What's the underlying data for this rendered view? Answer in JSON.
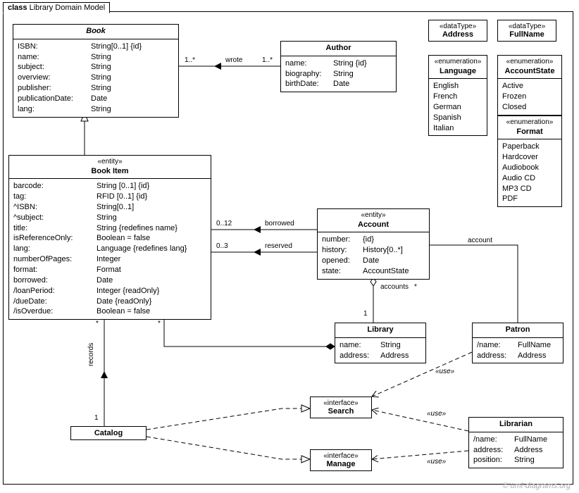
{
  "frame": {
    "keyword": "class",
    "title": "Library Domain Model"
  },
  "watermark": "© uml-diagrams.org",
  "book": {
    "name": "Book",
    "attrs": [
      {
        "n": "ISBN:",
        "t": "String[0..1] {id}"
      },
      {
        "n": "name:",
        "t": "String"
      },
      {
        "n": "subject:",
        "t": "String"
      },
      {
        "n": "overview:",
        "t": "String"
      },
      {
        "n": "publisher:",
        "t": "String"
      },
      {
        "n": "publicationDate:",
        "t": "Date"
      },
      {
        "n": "lang:",
        "t": "String"
      }
    ]
  },
  "author": {
    "name": "Author",
    "attrs": [
      {
        "n": "name:",
        "t": "String {id}"
      },
      {
        "n": "biography:",
        "t": "String"
      },
      {
        "n": "birthDate:",
        "t": "Date"
      }
    ]
  },
  "bookItem": {
    "stereo": "«entity»",
    "name": "Book Item",
    "attrs": [
      {
        "n": "barcode:",
        "t": "String [0..1] {id}"
      },
      {
        "n": "tag:",
        "t": "RFID [0..1] {id}"
      },
      {
        "n": "^ISBN:",
        "t": "String[0..1]"
      },
      {
        "n": "^subject:",
        "t": "String"
      },
      {
        "n": "title:",
        "t": "String {redefines name}"
      },
      {
        "n": "isReferenceOnly:",
        "t": "Boolean = false"
      },
      {
        "n": "lang:",
        "t": "Language {redefines lang}"
      },
      {
        "n": "numberOfPages:",
        "t": "Integer"
      },
      {
        "n": "format:",
        "t": "Format"
      },
      {
        "n": "borrowed:",
        "t": "Date"
      },
      {
        "n": "/loanPeriod:",
        "t": "Integer {readOnly}"
      },
      {
        "n": "/dueDate:",
        "t": "Date {readOnly}"
      },
      {
        "n": "/isOverdue:",
        "t": "Boolean = false"
      }
    ]
  },
  "account": {
    "stereo": "«entity»",
    "name": "Account",
    "attrs": [
      {
        "n": "number:",
        "t": "{id}"
      },
      {
        "n": "history:",
        "t": "History[0..*]"
      },
      {
        "n": "opened:",
        "t": "Date"
      },
      {
        "n": "state:",
        "t": "AccountState"
      }
    ]
  },
  "library": {
    "name": "Library",
    "attrs": [
      {
        "n": "name:",
        "t": "String"
      },
      {
        "n": "address:",
        "t": "Address"
      }
    ]
  },
  "patron": {
    "name": "Patron",
    "attrs": [
      {
        "n": "/name:",
        "t": "FullName"
      },
      {
        "n": "address:",
        "t": "Address"
      }
    ]
  },
  "catalog": {
    "name": "Catalog"
  },
  "search": {
    "stereo": "«interface»",
    "name": "Search"
  },
  "manage": {
    "stereo": "«interface»",
    "name": "Manage"
  },
  "librarian": {
    "name": "Librarian",
    "attrs": [
      {
        "n": "/name:",
        "t": "FullName"
      },
      {
        "n": "address:",
        "t": "Address"
      },
      {
        "n": "position:",
        "t": "String"
      }
    ]
  },
  "dtAddress": {
    "stereo": "«dataType»",
    "name": "Address"
  },
  "dtFullName": {
    "stereo": "«dataType»",
    "name": "FullName"
  },
  "enumLanguage": {
    "stereo": "«enumeration»",
    "name": "Language",
    "lits": [
      "English",
      "French",
      "German",
      "Spanish",
      "Italian"
    ]
  },
  "enumAccountState": {
    "stereo": "«enumeration»",
    "name": "AccountState",
    "lits": [
      "Active",
      "Frozen",
      "Closed"
    ]
  },
  "enumFormat": {
    "stereo": "«enumeration»",
    "name": "Format",
    "lits": [
      "Paperback",
      "Hardcover",
      "Audiobook",
      "Audio CD",
      "MP3 CD",
      "PDF"
    ]
  },
  "assoc": {
    "wroteLeft": "1..*",
    "wrote": "wrote",
    "wroteRight": "1..*",
    "borrowedMult": "0..12",
    "borrowed": "borrowed",
    "reservedMult": "0..3",
    "reserved": "reserved",
    "accountRole": "account",
    "accountsRole": "accounts",
    "accountsMult": "*",
    "libOne": "1",
    "bookItemStar": "*",
    "bookItemStar2": "*",
    "records": "records",
    "catalogOne": "1",
    "use": "«use»"
  }
}
